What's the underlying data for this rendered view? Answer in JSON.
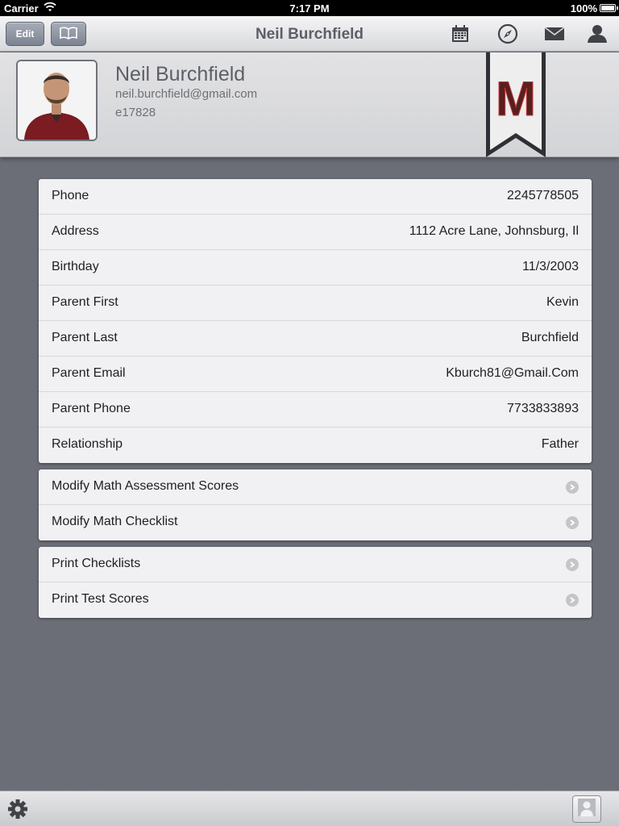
{
  "statusbar": {
    "carrier": "Carrier",
    "time": "7:17 PM",
    "battery": "100%"
  },
  "navbar": {
    "edit_label": "Edit",
    "title": "Neil Burchfield",
    "icons": [
      "book-icon",
      "calendar-icon",
      "compass-icon",
      "mail-icon",
      "person-icon"
    ]
  },
  "profile": {
    "name": "Neil Burchfield",
    "email": "neil.burchfield@gmail.com",
    "id": "e17828",
    "ribbon_letter": "M"
  },
  "details": [
    {
      "label": "Phone",
      "value": "2245778505"
    },
    {
      "label": "Address",
      "value": "1112 Acre Lane, Johnsburg, Il"
    },
    {
      "label": "Birthday",
      "value": "11/3/2003"
    },
    {
      "label": "Parent First",
      "value": "Kevin"
    },
    {
      "label": "Parent Last",
      "value": "Burchfield"
    },
    {
      "label": "Parent Email",
      "value": "Kburch81@Gmail.Com"
    },
    {
      "label": "Parent Phone",
      "value": "7733833893"
    },
    {
      "label": "Relationship",
      "value": "Father"
    }
  ],
  "math_actions": [
    {
      "label": "Modify Math Assessment Scores"
    },
    {
      "label": "Modify Math Checklist"
    }
  ],
  "print_actions": [
    {
      "label": "Print Checklists"
    },
    {
      "label": "Print Test Scores"
    }
  ],
  "colors": {
    "background": "#6b6e77",
    "ribbon_letter": "#5a1f1f",
    "card": "#f1f1f3"
  }
}
